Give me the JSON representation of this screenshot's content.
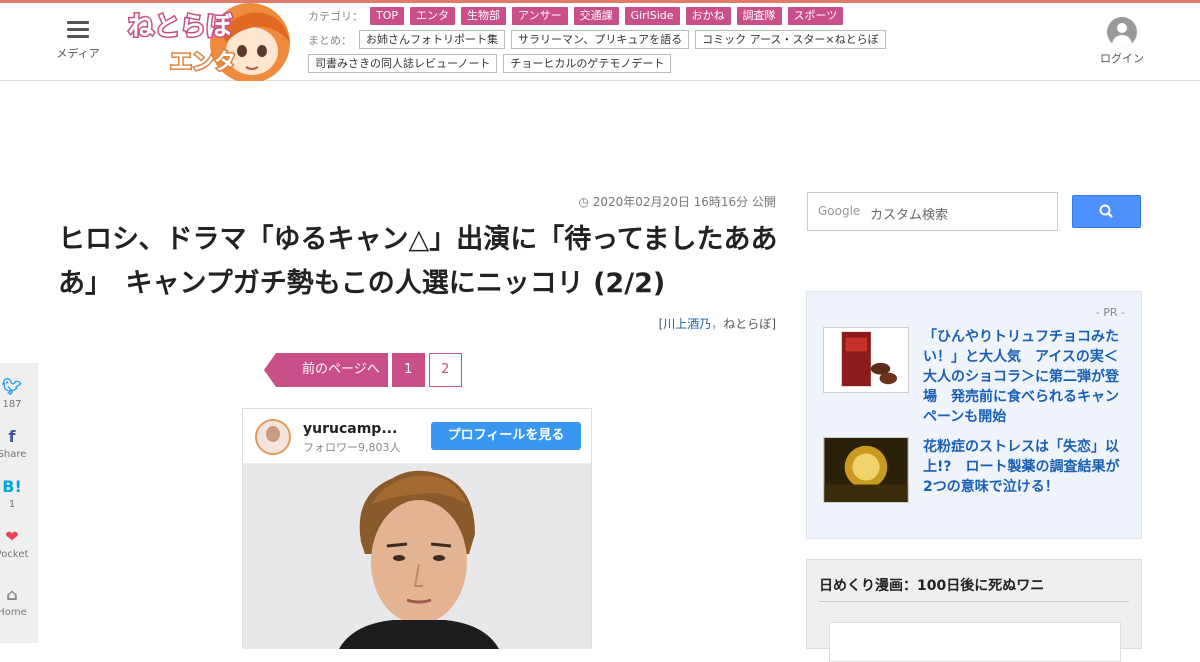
{
  "header": {
    "menu_label": "メディア",
    "login_label": "ログイン",
    "logo_alt": "ねとらぼ エンタ",
    "category_label": "カテゴリ：",
    "categories": [
      "TOP",
      "エンタ",
      "生物部",
      "アンサー",
      "交通課",
      "GirlSide",
      "おかね",
      "調査隊",
      "スポーツ"
    ],
    "matome_label": "まとめ：",
    "matome_row1": [
      "お姉さんフォトリポート集",
      "サラリーマン、プリキュアを語る",
      "コミック アース・スター×ねとらぼ"
    ],
    "matome_row2": [
      "司書みさきの同人誌レビューノート",
      "チョーヒカルのゲテモノデート"
    ],
    "accent_color": "#c84f87"
  },
  "article": {
    "published": "2020年02月20日 16時16分 公開",
    "title": "ヒロシ、ドラマ「ゆるキャン△」出演に「待ってましたあああ」　キャンプガチ勢もこの人選にニッコリ (2/2)",
    "author": "川上酒乃",
    "byline_sep": "，",
    "site": "ねとらぼ"
  },
  "pager": {
    "prev_label": "前のページへ",
    "pages": [
      "1",
      "2"
    ],
    "current": "1"
  },
  "instagram": {
    "username": "yurucamp...",
    "followers": "フォロワー9,803人",
    "button": "プロフィールを見る"
  },
  "search": {
    "google_label": "Google",
    "placeholder": "カスタム検索",
    "icon": "search-icon"
  },
  "pr": {
    "label": "- PR -",
    "items": [
      {
        "text": "「ひんやりトリュフチョコみたい！」と大人気　アイスの実＜大人のショコラ＞に第二弾が登場　発売前に食べられるキャンペーンも開始"
      },
      {
        "text": "花粉症のストレスは「失恋」以上!?　ロート製薬の調査結果が2つの意味で泣ける！"
      }
    ]
  },
  "sidebar": {
    "manga_title": "日めくり漫画：100日後に死ぬワニ"
  },
  "share": [
    {
      "icon": "twitter-icon",
      "count": "187"
    },
    {
      "icon": "facebook-icon",
      "count": "Share"
    },
    {
      "icon": "hatena-icon",
      "count": "1"
    },
    {
      "icon": "pocket-icon",
      "count": "Pocket"
    },
    {
      "icon": "home-icon",
      "count": "Home"
    }
  ]
}
